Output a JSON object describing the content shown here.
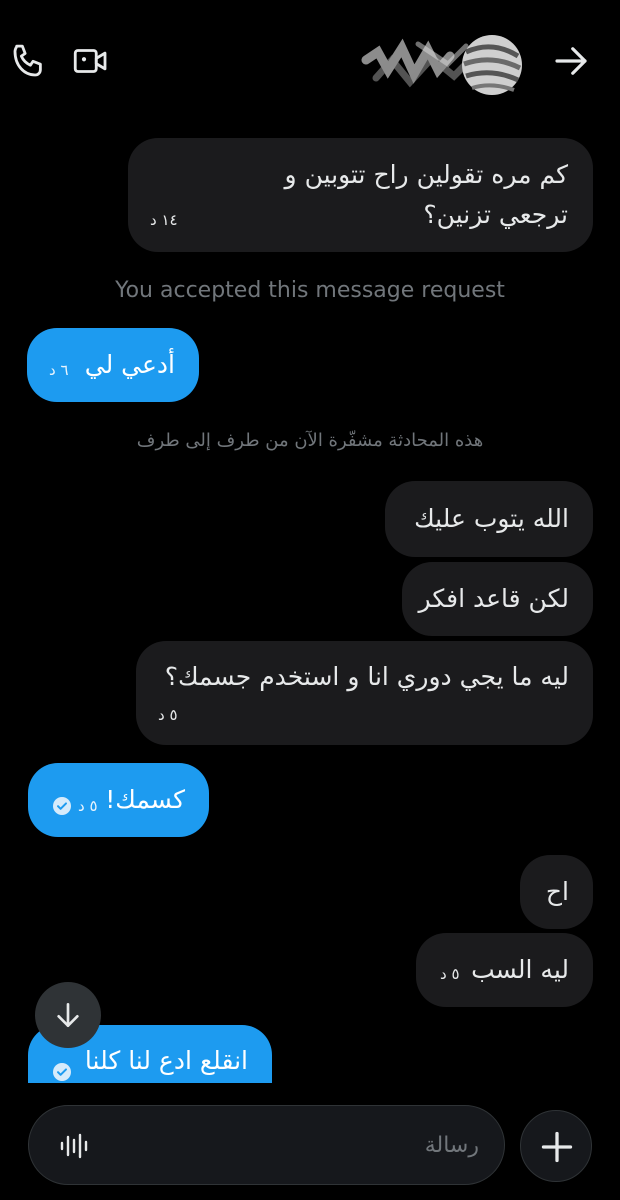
{
  "header": {
    "call_icon": "phone-icon",
    "video_icon": "video-camera-icon",
    "back_icon": "arrow-right-icon"
  },
  "messages": [
    {
      "text": "كم مره تقولين راح تتوبين و ترجعي تزنين؟",
      "time": "١٤ د"
    },
    {
      "text": "أدعي لي",
      "time": "٦ د"
    },
    {
      "text": "الله يتوب عليك"
    },
    {
      "text": "لكن قاعد افكر"
    },
    {
      "text": "ليه ما يجي دوري انا و استخدم جسمك؟",
      "time": "٥ د"
    },
    {
      "text": "كسمك!",
      "time": "٥ د"
    },
    {
      "text": "اح"
    },
    {
      "text": "ليه السب",
      "time": "٥ د"
    },
    {
      "text": "انقلع ادع لنا كلنا"
    }
  ],
  "system": {
    "accepted": "You accepted this message request",
    "encrypted": "هذه المحادثة مشفّرة الآن من طرف إلى طرف"
  },
  "composer": {
    "placeholder": "رسالة"
  },
  "colors": {
    "background": "#000000",
    "sent_bubble": "#1d9bf0",
    "received_bubble": "#1b1b1d",
    "muted_text": "#71767b"
  }
}
